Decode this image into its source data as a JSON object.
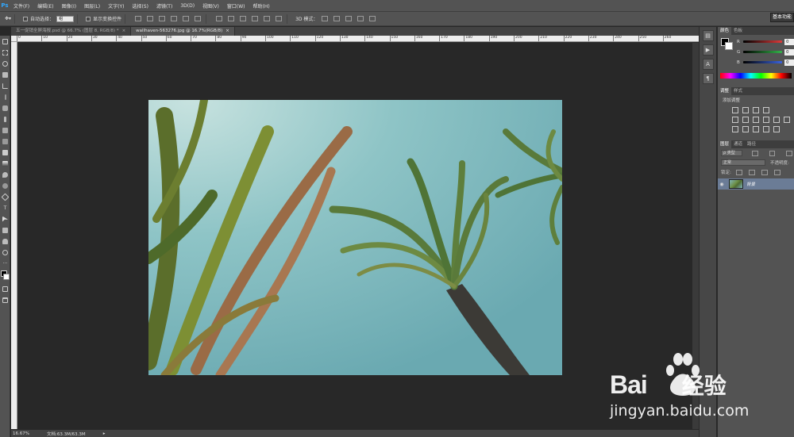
{
  "app": {
    "logo": "Ps"
  },
  "menu": [
    "文件(F)",
    "编辑(E)",
    "图像(I)",
    "图层(L)",
    "文字(Y)",
    "选择(S)",
    "滤镜(T)",
    "3D(D)",
    "视图(V)",
    "窗口(W)",
    "帮助(H)"
  ],
  "options": {
    "auto_select_label": "自动选择：",
    "auto_select_value": "组",
    "show_transform_label": "显示变换控件",
    "mode_3d_label": "3D 模式："
  },
  "workspace": "基本功能",
  "tabs": [
    {
      "label": "五一促销全屏海报.psd @ 66.7% (图层 8, RGB/8) *",
      "close": "×"
    },
    {
      "label": "wallhaven-563276.jpg @ 16.7%(RGB/8)",
      "close": "×"
    }
  ],
  "ruler": [
    "0",
    "10",
    "20",
    "30",
    "40",
    "50",
    "60",
    "70",
    "80",
    "90",
    "100",
    "110",
    "120",
    "130",
    "140",
    "150",
    "160",
    "170",
    "180",
    "190",
    "200",
    "210",
    "220",
    "230",
    "240",
    "250",
    "260"
  ],
  "status": {
    "zoom": "16.67%",
    "doc": "文档:63.3M/63.3M"
  },
  "panels": {
    "color_tabs": [
      "颜色",
      "色板"
    ],
    "rgb": [
      {
        "label": "R",
        "value": "0",
        "color": "#e03a3a"
      },
      {
        "label": "G",
        "value": "0",
        "color": "#34b34a"
      },
      {
        "label": "B",
        "value": "0",
        "color": "#3a63e0"
      }
    ],
    "adjust_tabs": [
      "调整",
      "样式"
    ],
    "adjust_title": "添加调整",
    "layers_tabs": [
      "图层",
      "通道",
      "路径"
    ],
    "kind_label": "ρ 类型",
    "blend_mode": "正常",
    "opacity_label": "不透明度:",
    "lock_label": "锁定:",
    "layer_name": "背景"
  },
  "watermark": {
    "brand": "Bai",
    "brand_cn": "经验",
    "url": "jingyan.baidu.com"
  },
  "colors": {
    "accent": "#31a8ff",
    "selected_layer": "#6b7c96",
    "sky": "#79b3b8"
  }
}
